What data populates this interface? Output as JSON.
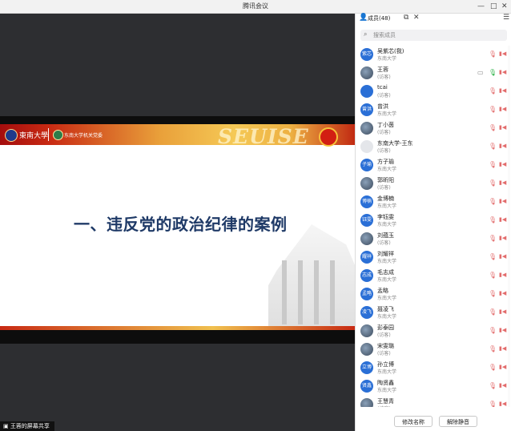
{
  "window": {
    "title": "腾讯会议",
    "min": "—",
    "max": "□",
    "close": "✕"
  },
  "slide": {
    "heading": "一、违反党的政治纪律的案例",
    "banner_text": "SEUISE",
    "logo_text": "東南大學",
    "logo2_text": "东南大学机关党委"
  },
  "share_badge": "王蓉的屏幕共享",
  "panel": {
    "title": "成员(48)",
    "search_placeholder": "搜索成员",
    "members": [
      {
        "name": "吴紫芯(我)",
        "note": "东南大学",
        "avatar": "紫芯",
        "avatar_type": "blue",
        "mic_on": false
      },
      {
        "name": "王蓉",
        "note": "(访客)",
        "avatar": "",
        "avatar_type": "photo",
        "mic_on": true,
        "sharing": true
      },
      {
        "name": "tcai",
        "note": "(访客)",
        "avatar": "",
        "avatar_type": "blue",
        "mic_on": false
      },
      {
        "name": "曾洪",
        "note": "东南大学",
        "avatar": "曾洪",
        "avatar_type": "blue",
        "mic_on": false
      },
      {
        "name": "丁小茵",
        "note": "(访客)",
        "avatar": "",
        "avatar_type": "photo",
        "mic_on": false
      },
      {
        "name": "东南大学-王东",
        "note": "(访客)",
        "avatar": "",
        "avatar_type": "grey",
        "mic_on": false
      },
      {
        "name": "方子瑜",
        "note": "东南大学",
        "avatar": "子瑜",
        "avatar_type": "blue",
        "mic_on": false
      },
      {
        "name": "郭昕阳",
        "note": "(访客)",
        "avatar": "",
        "avatar_type": "photo",
        "mic_on": false
      },
      {
        "name": "金博楠",
        "note": "东南大学",
        "avatar": "博楠",
        "avatar_type": "blue",
        "mic_on": false
      },
      {
        "name": "李钰雯",
        "note": "东南大学",
        "avatar": "钰雯",
        "avatar_type": "blue",
        "mic_on": false
      },
      {
        "name": "刘蕴玉",
        "note": "(访客)",
        "avatar": "",
        "avatar_type": "photo",
        "mic_on": false
      },
      {
        "name": "刘耀祥",
        "note": "东南大学",
        "avatar": "耀祥",
        "avatar_type": "blue",
        "mic_on": false
      },
      {
        "name": "毛志成",
        "note": "东南大学",
        "avatar": "志成",
        "avatar_type": "blue",
        "mic_on": false
      },
      {
        "name": "孟略",
        "note": "东南大学",
        "avatar": "孟略",
        "avatar_type": "blue",
        "mic_on": false
      },
      {
        "name": "聂凌飞",
        "note": "东南大学",
        "avatar": "凌飞",
        "avatar_type": "blue",
        "mic_on": false
      },
      {
        "name": "彭泰园",
        "note": "(访客)",
        "avatar": "",
        "avatar_type": "photo",
        "mic_on": false
      },
      {
        "name": "宋雯璐",
        "note": "(访客)",
        "avatar": "",
        "avatar_type": "photo",
        "mic_on": false
      },
      {
        "name": "孙立博",
        "note": "东南大学",
        "avatar": "立博",
        "avatar_type": "blue",
        "mic_on": false
      },
      {
        "name": "陶贤鑫",
        "note": "东南大学",
        "avatar": "贤鑫",
        "avatar_type": "blue",
        "mic_on": false
      },
      {
        "name": "王慧青",
        "note": "(访客)",
        "avatar": "",
        "avatar_type": "photo",
        "mic_on": false
      }
    ],
    "rename_btn": "修改名称",
    "unmute_btn": "解除静音"
  },
  "icons": {
    "mic": "🎙",
    "camera": "▮◀",
    "screen": "▭"
  },
  "colors": {
    "avatar_blue": "#2a6fd6",
    "mic_muted": "#e26c6c",
    "mic_on": "#2fb34a"
  }
}
